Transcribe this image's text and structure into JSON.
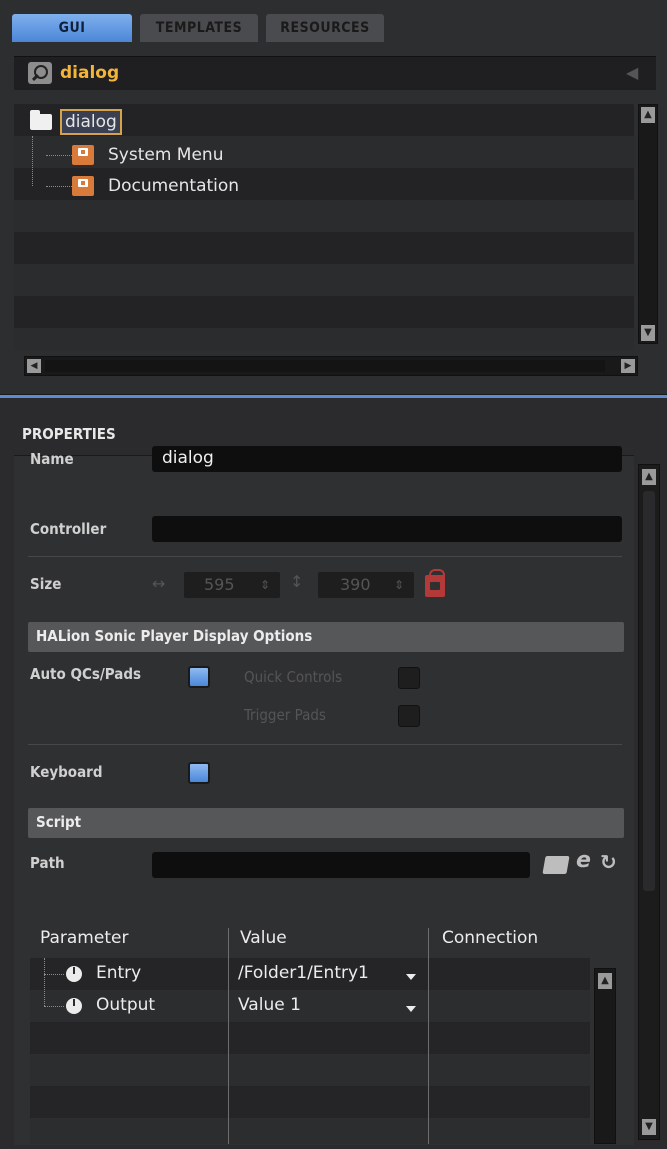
{
  "tabs": [
    {
      "label": "GUI",
      "active": true
    },
    {
      "label": "TEMPLATES",
      "active": false
    },
    {
      "label": "RESOURCES",
      "active": false
    }
  ],
  "search": {
    "value": "dialog"
  },
  "tree": {
    "root": {
      "label": "dialog",
      "icon": "folder-icon"
    },
    "children": [
      {
        "label": "System Menu",
        "icon": "template-icon"
      },
      {
        "label": "Documentation",
        "icon": "template-icon"
      }
    ]
  },
  "properties": {
    "header": "PROPERTIES",
    "name_label": "Name",
    "name_value": "dialog",
    "controller_label": "Controller",
    "controller_value": "",
    "size_label": "Size",
    "width": "595",
    "height": "390",
    "display_section": "HALion Sonic Player Display Options",
    "auto_qc_label": "Auto QCs/Pads",
    "auto_qc_checked": true,
    "quick_controls_label": "Quick Controls",
    "trigger_pads_label": "Trigger Pads",
    "keyboard_label": "Keyboard",
    "keyboard_checked": true,
    "script_section": "Script",
    "path_label": "Path",
    "path_value": ""
  },
  "table": {
    "headers": [
      "Parameter",
      "Value",
      "Connection"
    ],
    "rows": [
      {
        "parameter": "Entry",
        "value": "/Folder1/Entry1",
        "connection": ""
      },
      {
        "parameter": "Output",
        "value": "Value 1",
        "connection": ""
      }
    ]
  },
  "colors": {
    "accent": "#5a8cd0",
    "search_text": "#f2b53a",
    "selection_border": "#d6a24a",
    "lock": "#b43a3a"
  }
}
